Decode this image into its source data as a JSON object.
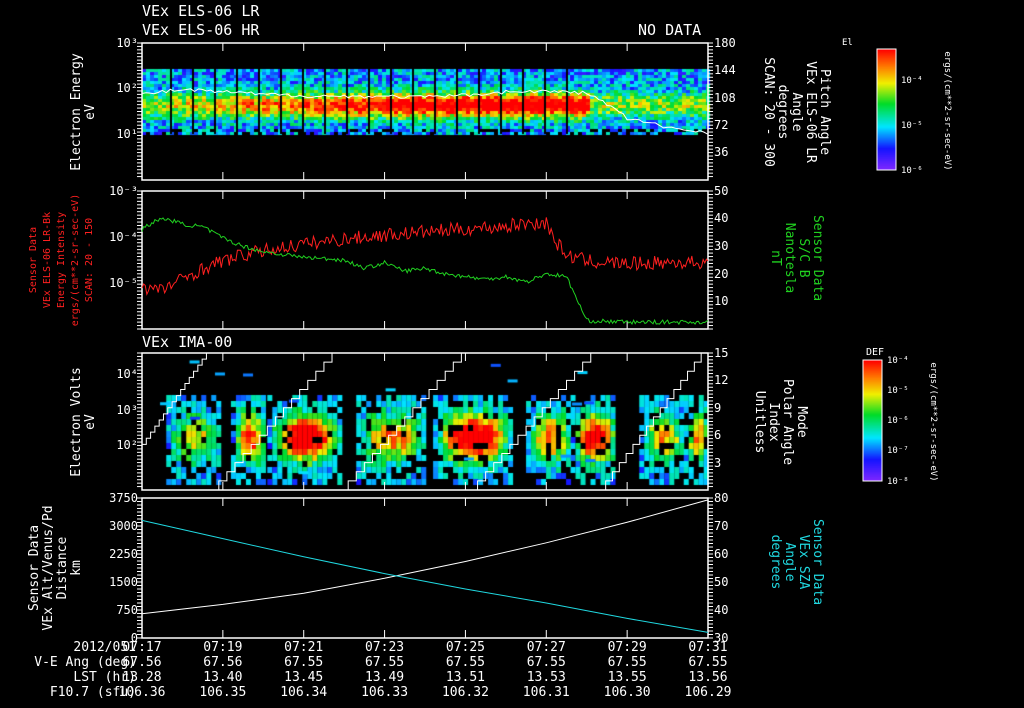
{
  "header": {
    "title_lr": "VEx ELS-06 LR",
    "title_hr": "VEx ELS-06 HR",
    "no_data": "NO DATA"
  },
  "colors": {
    "background": "#000000",
    "axis": "#ffffff",
    "red_series": "#ff2020",
    "green_series": "#20d020",
    "cyan_series": "#20d8e0",
    "white_series": "#ffffff"
  },
  "panels": {
    "p1": {
      "ylabel": [
        "Electron Energy",
        "eV"
      ],
      "yticks": [
        "10³",
        "10²",
        "10¹"
      ],
      "rticks": [
        "180",
        "144",
        "108",
        "72",
        "36"
      ],
      "rlabel": [
        "Pitch Angle",
        "VEx ELS-06 LR",
        "Angle",
        "degrees",
        "SCAN: 20 - 300"
      ],
      "colorbar": {
        "title": "El",
        "ticks": [
          "10⁻⁴",
          "10⁻⁵",
          "10⁻⁶"
        ],
        "unit": "ergs/(cm**2-sr-sec-eV)"
      }
    },
    "p2": {
      "ylabel": [
        "Sensor Data",
        "VEx ELS-06 LR-Bk",
        "Energy Intensity",
        "ergs/(cm**2-sr-sec-eV)",
        "SCAN: 20 - 150"
      ],
      "yticks": [
        "10⁻³",
        "10⁻⁴",
        "10⁻⁵"
      ],
      "rticks": [
        "50",
        "40",
        "30",
        "20",
        "10"
      ],
      "rlabel": [
        "Sensor Data",
        "S/C B",
        "Nanotesla",
        "nT"
      ]
    },
    "p3": {
      "title": "VEx IMA-00",
      "ylabel": [
        "Electron Volts",
        "eV"
      ],
      "yticks": [
        "10⁴",
        "10³",
        "10²"
      ],
      "rticks": [
        "15",
        "12",
        "9",
        "6",
        "3"
      ],
      "rlabel": [
        "Mode",
        "Polar Angle",
        "Index",
        "Unitless"
      ],
      "colorbar": {
        "title": "DEF",
        "ticks": [
          "10⁻⁴",
          "10⁻⁵",
          "10⁻⁶",
          "10⁻⁷",
          "10⁻⁸"
        ],
        "unit": "ergs/(cm**2-sr-sec-eV)"
      }
    },
    "p4": {
      "ylabel": [
        "Sensor Data",
        "VEx Alt/Venus/Pd",
        "Distance",
        "km"
      ],
      "yticks": [
        "3750",
        "3000",
        "2250",
        "1500",
        "750",
        "0"
      ],
      "rticks": [
        "80",
        "70",
        "60",
        "50",
        "40",
        "30"
      ],
      "rlabel": [
        "Sensor Data",
        "VEx SZA",
        "Angle",
        "degrees"
      ]
    }
  },
  "footer": {
    "rows": [
      {
        "label": "2012/051",
        "values": [
          "07:17",
          "07:19",
          "07:21",
          "07:23",
          "07:25",
          "07:27",
          "07:29",
          "07:31"
        ]
      },
      {
        "label": "V-E Ang (deg)",
        "values": [
          "67.56",
          "67.56",
          "67.55",
          "67.55",
          "67.55",
          "67.55",
          "67.55",
          "67.55"
        ]
      },
      {
        "label": "LST (hr)",
        "values": [
          "13.28",
          "13.40",
          "13.45",
          "13.49",
          "13.51",
          "13.53",
          "13.55",
          "13.56"
        ]
      },
      {
        "label": "F10.7 (sfu)",
        "values": [
          "106.36",
          "106.35",
          "106.34",
          "106.33",
          "106.32",
          "106.31",
          "106.30",
          "106.29"
        ]
      }
    ]
  },
  "chart_data": [
    {
      "type": "heatmap",
      "panel": "p1",
      "x_range": [
        "07:17",
        "07:31"
      ],
      "y_scale": "log",
      "ylim": [
        1,
        1000
      ],
      "ylabel": "Electron Energy eV",
      "overlay_series": {
        "color": "#ffffff",
        "x_min": [
          0,
          1,
          2,
          3,
          4,
          5,
          6,
          7,
          8,
          9,
          10,
          11,
          11.5,
          12,
          13,
          14
        ],
        "y": [
          75,
          95,
          85,
          75,
          70,
          68,
          68,
          65,
          72,
          85,
          88,
          80,
          45,
          22,
          14,
          11
        ]
      }
    },
    {
      "type": "line",
      "panel": "p2",
      "series": [
        {
          "axis": "left",
          "scale": "log",
          "ylim": [
            1e-06,
            0.001
          ],
          "color": "#ff2020",
          "x_min": [
            0,
            0.5,
            1,
            1.5,
            2,
            2.5,
            3,
            4,
            5,
            6,
            7,
            8,
            9,
            9.5,
            10,
            10.2,
            10.5,
            11,
            12,
            13,
            14
          ],
          "y": [
            8e-06,
            7e-06,
            1.2e-05,
            2e-05,
            3e-05,
            4e-05,
            5e-05,
            7e-05,
            9e-05,
            0.00011,
            0.00013,
            0.00015,
            0.00017,
            0.0002,
            0.0002,
            8e-05,
            4e-05,
            3e-05,
            2.6e-05,
            2.8e-05,
            2.8e-05
          ]
        },
        {
          "axis": "right",
          "scale": "linear",
          "ylim": [
            0,
            50
          ],
          "color": "#20d020",
          "x_min": [
            0,
            0.3,
            0.6,
            1,
            1.5,
            2,
            2.5,
            3,
            4,
            5,
            5.5,
            6,
            6.5,
            7,
            7.5,
            8,
            8.5,
            9,
            9.5,
            10,
            10.5,
            11,
            12,
            13,
            14
          ],
          "y": [
            36,
            39,
            40,
            38,
            37,
            33,
            30,
            28,
            26,
            25,
            22,
            24,
            21,
            22,
            20,
            19,
            18,
            19,
            17,
            20,
            19,
            3,
            2.5,
            2.5,
            2.5
          ]
        }
      ]
    },
    {
      "type": "heatmap",
      "panel": "p3",
      "x_range": [
        "07:17",
        "07:31"
      ],
      "y_scale": "log",
      "ylabel": "Electron Volts eV",
      "overlay_series": {
        "color": "#ffffff",
        "axis": "right",
        "ylim": [
          0,
          15
        ],
        "resets_at": [
          "07:18.7",
          "07:21.9",
          "07:25.1",
          "07:28.3"
        ]
      }
    },
    {
      "type": "line",
      "panel": "p4",
      "series": [
        {
          "axis": "left",
          "ylim": [
            0,
            3750
          ],
          "color": "#ffffff",
          "x_min": [
            0,
            2,
            4,
            6,
            8,
            10,
            12,
            14
          ],
          "y": [
            650,
            900,
            1200,
            1600,
            2050,
            2550,
            3100,
            3700
          ]
        },
        {
          "axis": "right",
          "ylim": [
            30,
            80
          ],
          "color": "#20d8e0",
          "x_min": [
            0,
            2,
            4,
            6,
            8,
            10,
            12,
            14
          ],
          "y": [
            72,
            65.5,
            59,
            53,
            47.5,
            42.5,
            37,
            32
          ]
        }
      ]
    }
  ]
}
